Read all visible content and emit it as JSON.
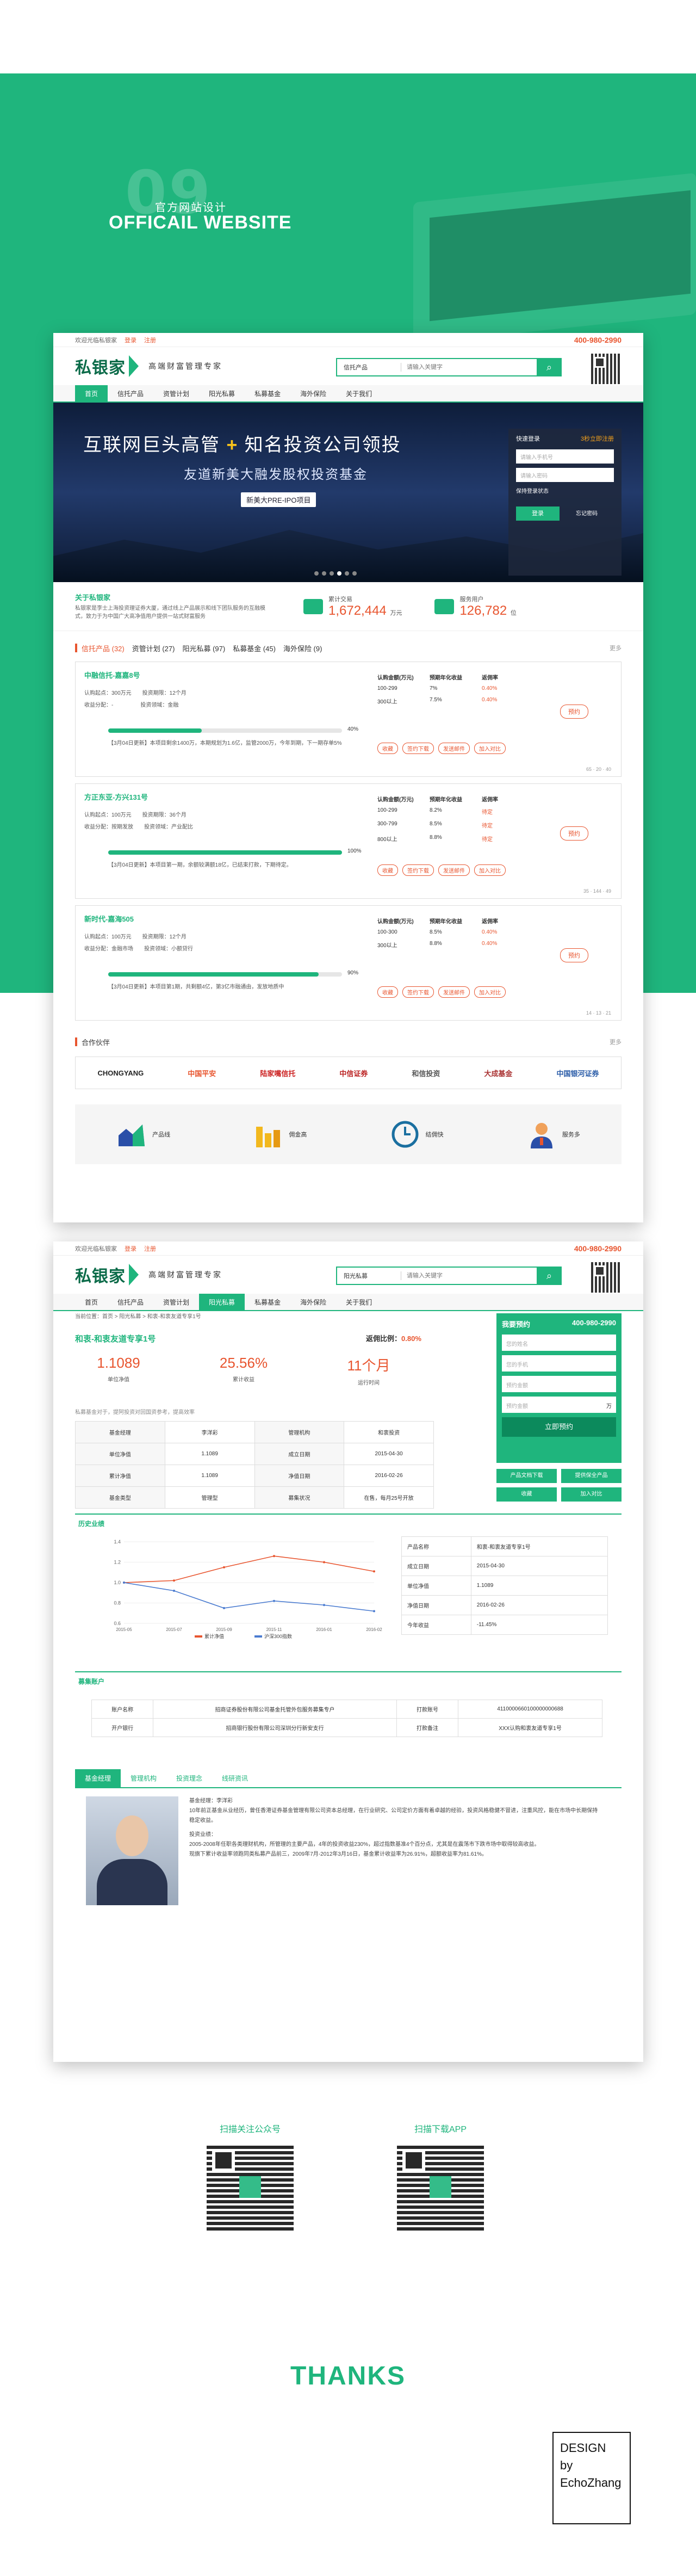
{
  "intro": {
    "number": "09",
    "title_cn": "官方网站设计",
    "title_en": "OFFICAIL WEBSITE"
  },
  "site": {
    "topbar": {
      "left1": "欢迎光临私银家",
      "login": "登录",
      "register": "注册",
      "phone": "400-980-2990"
    },
    "logo": "私银家",
    "slogan": "高端财富管理专家",
    "search": {
      "category": "信托产品",
      "placeholder": "请输入关键字"
    },
    "nav": [
      "首页",
      "信托产品",
      "资管计划",
      "阳光私募",
      "私募基金",
      "海外保险",
      "关于我们"
    ]
  },
  "banner": {
    "line1a": "互联网巨头高管",
    "plus": "+",
    "line1b": "知名投资公司领投",
    "line2": "友道新美大融发股权投资基金",
    "tag": "新美大PRE-IPO项目",
    "login": {
      "title": "快速登录",
      "register": "3秒立即注册",
      "user": "请输入手机号",
      "pwd": "请输入密码",
      "remember": "保持登录状态",
      "btn": "登录",
      "forgot": "忘记密码"
    }
  },
  "stats": {
    "about_title": "关于私银家",
    "about_text": "私银家是李士上海投资理证券大厦，通过线上产品展示和线下团队服务的互融模式，致力于为中国广大高净值用户提供一站式财富服务",
    "s1_label": "累计交易",
    "s1_val": "1,672,444",
    "s1_unit": "万元",
    "s2_label": "服务用户",
    "s2_val": "126,782",
    "s2_unit": "位"
  },
  "tabs": [
    "信托产品 (32)",
    "资管计划 (27)",
    "阳光私募 (97)",
    "私募基金 (45)",
    "海外保险 (9)"
  ],
  "more": "更多",
  "cards": [
    {
      "name": "中融信托-嘉嘉8号",
      "r1": "认购起点：300万元　　投资期限：12个月",
      "r2": "收益分配：-　　　　　投资领域：金融",
      "progress": 40,
      "pct": "40%",
      "desc": "【3月04日更新】本项目剩余1400万，本期规划为1.6亿，监管2000万，今年到期，下一期存单5%",
      "th": [
        "认购金额(万元)",
        "预期年化收益",
        "返佣率"
      ],
      "rows": [
        [
          "100-299",
          "7%",
          "0.40%"
        ],
        [
          "300以上",
          "7.5%",
          "0.40%"
        ]
      ],
      "btns": [
        "收藏",
        "签约下载",
        "发送邮件",
        "加入对比"
      ],
      "yy": "预约",
      "meta": "65  · 20  · 40"
    },
    {
      "name": "方正东亚-方兴131号",
      "r1": "认购起点：100万元　　投资期限：36个月",
      "r2": "收益分配：按期发放　　投资领域：产业配比",
      "progress": 100,
      "pct": "100%",
      "desc": "【3月04日更新】本项目第一期，余额较满额18亿，已结束打款，下期待定。",
      "th": [
        "认购金额(万元)",
        "预期年化收益",
        "返佣率"
      ],
      "rows": [
        [
          "100-299",
          "8.2%",
          "待定"
        ],
        [
          "300-799",
          "8.5%",
          "待定"
        ],
        [
          "800以上",
          "8.8%",
          "待定"
        ]
      ],
      "btns": [
        "收藏",
        "签约下载",
        "发送邮件",
        "加入对比"
      ],
      "yy": "预约",
      "meta": "35  · 144  · 49"
    },
    {
      "name": "新时代-嘉海505",
      "r1": "认购起点：100万元　　投资期限：12个月",
      "r2": "收益分配：金融市场　　投资领域：小额贷行",
      "progress": 90,
      "pct": "90%",
      "desc": "【3月04日更新】本项目第1期，共剩额4亿，第3亿市融通由，发放地质中",
      "th": [
        "认购金额(万元)",
        "预期年化收益",
        "返佣率"
      ],
      "rows": [
        [
          "100-300",
          "8.5%",
          "0.40%"
        ],
        [
          "300以上",
          "8.8%",
          "0.40%"
        ]
      ],
      "btns": [
        "收藏",
        "签约下载",
        "发送邮件",
        "加入对比"
      ],
      "yy": "预约",
      "meta": "14  · 13  · 21"
    }
  ],
  "partners_title": "合作伙伴",
  "partners": [
    "CHONGYANG",
    "中国平安",
    "陆家嘴信托",
    "中信证券",
    "和信投资",
    "大成基金",
    "中国银河证券"
  ],
  "features": [
    "产品线",
    "佣金高",
    "结佣快",
    "服务多"
  ],
  "detail": {
    "nav_active": "阳光私募",
    "search_cat": "阳光私募",
    "crumb": "当前位置：首页 > 阳光私募 > 和衷-和衷友道专享1号",
    "title": "和衷-和衷友道专享1号",
    "ret_label": "返佣比例：",
    "ret_val": "0.80%",
    "kpis": [
      {
        "v": "1.1089",
        "l": "单位净值"
      },
      {
        "v": "25.56%",
        "l": "累计收益"
      },
      {
        "v": "11个月",
        "l": "运行时间"
      }
    ],
    "note": "私募基金对于，提阿投资对回国资参考，提高效率",
    "table": [
      [
        "基金经理",
        "李洋彩",
        "管理机构",
        "和衷投资"
      ],
      [
        "单位净值",
        "1.1089",
        "成立日期",
        "2015-04-30"
      ],
      [
        "累计净值",
        "1.1089",
        "净值日期",
        "2016-02-26"
      ],
      [
        "基金类型",
        "管理型",
        "募集状况",
        "在售，每月25号开放"
      ]
    ],
    "reserve": {
      "title": "我要预约",
      "phone": "400-980-2990",
      "fields": [
        "您的姓名",
        "您的手机",
        "预约金额",
        "预约金额"
      ],
      "unit": "万",
      "btn": "立即预约"
    },
    "side_btns": [
      "产品文档下载",
      "提供保全产品",
      "收藏",
      "加入对比"
    ],
    "history_title": "历史业绩",
    "legend": [
      "累计净值",
      "沪深300指数"
    ],
    "info": [
      [
        "产品名称",
        "和衷-和衷友道专享1号"
      ],
      [
        "成立日期",
        "2015-04-30"
      ],
      [
        "单位净值",
        "1.1089"
      ],
      [
        "净值日期",
        "2016-02-26"
      ],
      [
        "今年收益",
        "-11.45%"
      ]
    ],
    "account_title": "募集账户",
    "account": [
      [
        "账户名称",
        "招商证券股份有限公司基金托管外包服务募集专户",
        "打款账号",
        "4110000660100000000688"
      ],
      [
        "开户银行",
        "招商银行股份有限公司深圳分行新安支行",
        "打款备注",
        "XXX认购和衷友道专享1号"
      ]
    ],
    "mtabs": [
      "基金经理",
      "管理机构",
      "投资理念",
      "线研资讯"
    ],
    "mgr": [
      "基金经理：李洋彩",
      "10年前正基金从业经历，曾任香港证券基金管理有限公司资本总经理，在行业研究、公司定价方面有着卓越的经验，投资风格稳健不冒进，注重风控，能在市场中长期保持稳定收益。",
      "投资业绩：",
      "2005-2008年任职各类理财机构，所管理的主要产品，4年的投资收益230%，超过指数基准4个百分点，尤其是在震荡市下跌市场中取得较高收益。",
      "现旗下累计收益率领跑同类私募产品前三，2009年7月-2012年3月16日，基金累计收益率为26.91%，超额收益率为81.61%。"
    ]
  },
  "chart_data": {
    "type": "line",
    "x": [
      "2015-05",
      "2015-07",
      "2015-09",
      "2015-11",
      "2016-01",
      "2016-02"
    ],
    "series": [
      {
        "name": "累计净值",
        "values": [
          1.0,
          1.02,
          1.15,
          1.26,
          1.2,
          1.11
        ]
      },
      {
        "name": "沪深300指数",
        "values": [
          1.0,
          0.92,
          0.75,
          0.82,
          0.78,
          0.72
        ]
      }
    ],
    "ylim": [
      0.6,
      1.4
    ],
    "colors": [
      "#e8552f",
      "#4a7bd0"
    ]
  },
  "footer": {
    "qr1": "扫描关注公众号",
    "qr2": "扫描下载APP",
    "thanks": "THANKS",
    "design": [
      "DESIGN",
      "by",
      "EchoZhang"
    ]
  }
}
